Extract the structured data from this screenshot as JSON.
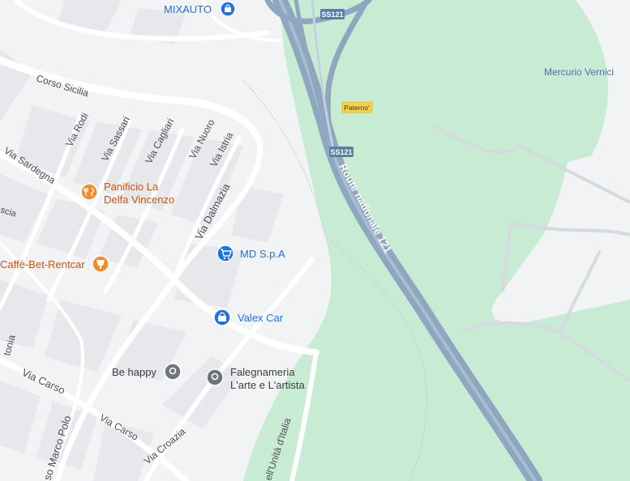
{
  "map": {
    "colors": {
      "park": "#c8ecd3",
      "road": "#ffffff",
      "highway": "#8fa6bf",
      "blocks": "#e8eaed",
      "poi_blue": "#1a73e8",
      "poi_orange": "#f28b2d",
      "poi_gray": "#70757a"
    },
    "streets": {
      "corso_sicilia": "Corso Sicilia",
      "via_sardegna": "Via Sardegna",
      "via_rodi": "Via Rodi",
      "via_sassari": "Via Sassari",
      "via_cagliari": "Via Cagliari",
      "via_nuoro": "Via Nuoro",
      "via_istria": "Via Istria",
      "via_dalmazia": "Via Dalmazia",
      "via_carso_1": "Via Carso",
      "via_carso_2": "Via Carso",
      "via_croazia": "Via Croazia",
      "marco_polo": "so Marco Polo",
      "unita_italia": "ell'Unità d'Italia",
      "scia": "scia",
      "tonia": "tonia"
    },
    "highway": {
      "name": "Route nationale 121",
      "shield_top": "SS121",
      "shield_mid": "SS121",
      "place_sign": "Paterno'"
    },
    "pois": {
      "mixauto": {
        "label": "MIXAUTO",
        "icon": "shopping-bag-icon"
      },
      "mercurio": {
        "label": "Mercurio Vernici"
      },
      "panificio": {
        "line1": "Panificio La",
        "line2": "Delfa Vincenzo",
        "icon": "restaurant-icon"
      },
      "caffe": {
        "label": "Caffè-Bet-Rentcar",
        "icon": "cafe-icon"
      },
      "md": {
        "label": "MD S.p.A",
        "icon": "shopping-cart-icon"
      },
      "valex": {
        "label": "Valex Car",
        "icon": "shopping-bag-icon"
      },
      "behappy": {
        "label": "Be happy",
        "icon": "place-pin-icon"
      },
      "falegnameria": {
        "line1": "Falegnameria",
        "line2": "L'arte e L'artista",
        "icon": "place-pin-icon"
      }
    }
  }
}
